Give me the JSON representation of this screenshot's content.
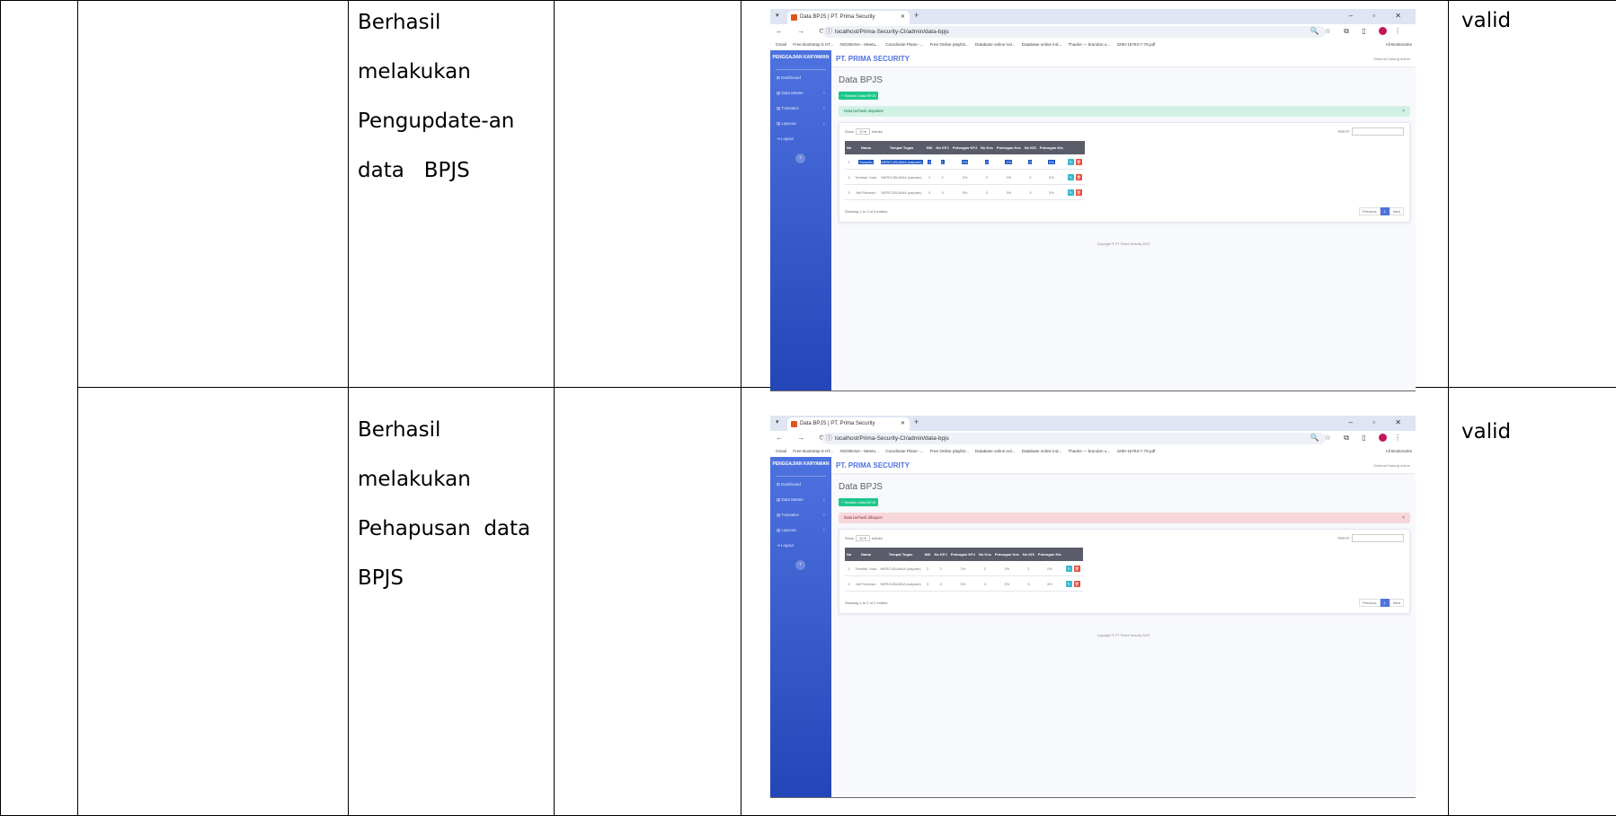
{
  "rows": [
    {
      "description_lines": [
        "Berhasil",
        "melakukan",
        "Pengupdate-an",
        "data   BPJS"
      ],
      "result": "valid",
      "screenshot": {
        "tab_title": "Data BPJS | PT. Prima Security",
        "url": "localhost/Prima-Security-CI/admin/data-bpjs",
        "alert_text": "Data berhasil diupdate!",
        "alert_color": "#d1f2e4",
        "alert_text_color": "#1a7a52",
        "table_rows": [
          {
            "no": "1",
            "nama": "Sunyoto",
            "tempat": "MERCUBUANA (satpam)",
            "nik": "1",
            "no_kpj": "1",
            "pot_kpj": "1%",
            "no_kes": "1",
            "pot_kes": "1%",
            "no_kis": "1",
            "pot_kis": "1%"
          },
          {
            "no": "2",
            "nama": "Tambak Yuda",
            "tempat": "MERCUBUANA (satpam)",
            "nik": "2",
            "no_kpj": "2",
            "pot_kpj": "2%",
            "no_kes": "2",
            "pot_kes": "2%",
            "no_kis": "2",
            "pot_kis": "2%"
          },
          {
            "no": "3",
            "nama": "Arif Rahman",
            "tempat": "MERCUBUANA (satpam)",
            "nik": "3",
            "no_kpj": "3",
            "pot_kpj": "3%",
            "no_kes": "3",
            "pot_kes": "3%",
            "no_kis": "3",
            "pot_kis": "3%"
          }
        ],
        "showing_text": "Showing 1 to 3 of 3 entries"
      }
    },
    {
      "description_lines": [
        "Berhasil",
        "melakukan",
        "Pehapusan  data",
        "BPJS"
      ],
      "result": "valid",
      "screenshot": {
        "tab_title": "Data BPJS | PT. Prima Security",
        "url": "localhost/Prima-Security-CI/admin/data-bpjs",
        "alert_text": "Data berhasil dihapus!",
        "alert_color": "#f8d7da",
        "alert_text_color": "#8a2b34",
        "table_rows": [
          {
            "no": "1",
            "nama": "Tambak Yuda",
            "tempat": "MERCUBUANA (satpam)",
            "nik": "2",
            "no_kpj": "2",
            "pot_kpj": "2%",
            "no_kes": "2",
            "pot_kes": "2%",
            "no_kis": "2",
            "pot_kis": "2%"
          },
          {
            "no": "2",
            "nama": "Arif Rahman",
            "tempat": "MERCUBUANA (satpam)",
            "nik": "3",
            "no_kpj": "3",
            "pot_kpj": "3%",
            "no_kes": "3",
            "pot_kes": "3%",
            "no_kis": "3",
            "pot_kis": "3%"
          }
        ],
        "showing_text": "Showing 1 to 2 of 2 entries"
      }
    }
  ],
  "app": {
    "brand": "PENGGAJIAN KARYAWAN",
    "company": "PT. PRIMA SECURITY",
    "user": "Selamat Datang admin",
    "page_title": "Data BPJS",
    "add_button": "+ Tambah Data BPJS",
    "menu": [
      "Dashboard",
      "Data Master",
      "Transaksi",
      "Laporan",
      "Logout"
    ],
    "show_label": "Show",
    "show_value": "10",
    "entries_label": "entries",
    "search_label": "Search:",
    "columns": [
      "No",
      "Nama",
      "Tempat Tugas",
      "NIK",
      "No KPJ",
      "Potongan KPJ",
      "No Kes",
      "Potongan Kes",
      "No KIS",
      "Potongan Kis",
      ""
    ],
    "previous": "Previous",
    "page": "1",
    "next": "Next",
    "copyright": "Copyright © PT. Prima Security 2023",
    "bookmarks": [
      "Gmail",
      "Free Bootstrap 5 HT...",
      "NOOBANA - Meetu...",
      "Coordinate Plane -...",
      "Free Online playlist...",
      "Database online ind...",
      "Database online ind...",
      "Thanks — brandon u...",
      "4290-15783-7-78.pdf"
    ],
    "all_bookmarks": "All Bookmarks"
  }
}
